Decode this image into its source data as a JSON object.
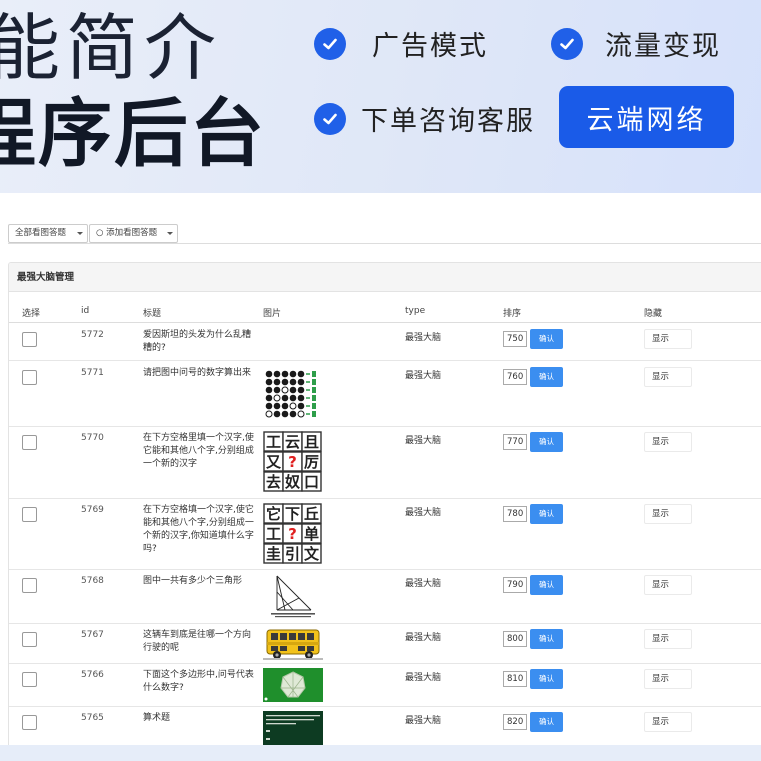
{
  "hero": {
    "title_line1": "能简介",
    "title_line2": "程序后台",
    "features": [
      "广告模式",
      "流量变现",
      "下单咨询客服"
    ],
    "brand_button": "云端网络",
    "accent": "#1a5be8"
  },
  "toolbar": {
    "tab_all": "全部看图答题",
    "tab_add": "○ 添加看图答题"
  },
  "panel": {
    "title": "最强大脑管理",
    "columns": [
      "选择",
      "id",
      "标题",
      "图片",
      "type",
      "排序",
      "隐藏"
    ]
  },
  "rows": [
    {
      "id": "5772",
      "title": "爱因斯坦的头发为什么乱糟糟的?",
      "type": "最强大脑",
      "sort": "750",
      "confirm": "确认",
      "hide": "显示",
      "image": "none"
    },
    {
      "id": "5771",
      "title": "请把图中问号的数字算出来",
      "type": "最强大脑",
      "sort": "760",
      "confirm": "确认",
      "hide": "显示",
      "image": "dots-puzzle"
    },
    {
      "id": "5770",
      "title": "在下方空格里填一个汉字,使它能和其他八个字,分别组成一个新的汉字",
      "type": "最强大脑",
      "sort": "770",
      "confirm": "确认",
      "hide": "显示",
      "image": "character-grid",
      "grid": [
        "工",
        "云",
        "且",
        "又",
        "?",
        "厉",
        "去",
        "奴",
        "口"
      ]
    },
    {
      "id": "5769",
      "title": "在下方空格填一个汉字,使它能和其他八个字,分别组成一个新的汉字,你知道填什么字吗?",
      "type": "最强大脑",
      "sort": "780",
      "confirm": "确认",
      "hide": "显示",
      "image": "character-grid",
      "grid": [
        "它",
        "下",
        "丘",
        "工",
        "?",
        "单",
        "圭",
        "引",
        "文"
      ]
    },
    {
      "id": "5768",
      "title": "图中一共有多少个三角形",
      "type": "最强大脑",
      "sort": "790",
      "confirm": "确认",
      "hide": "显示",
      "image": "triangle-puzzle"
    },
    {
      "id": "5767",
      "title": "这辆车到底是往哪一个方向行驶的呢",
      "type": "最强大脑",
      "sort": "800",
      "confirm": "确认",
      "hide": "显示",
      "image": "bus"
    },
    {
      "id": "5766",
      "title": "下面这个多边形中,问号代表什么数字?",
      "type": "最强大脑",
      "sort": "810",
      "confirm": "确认",
      "hide": "显示",
      "image": "polygon-puzzle"
    },
    {
      "id": "5765",
      "title": "算术题",
      "type": "最强大脑",
      "sort": "820",
      "confirm": "确认",
      "hide": "显示",
      "image": "arithmetic-puzzle"
    }
  ]
}
